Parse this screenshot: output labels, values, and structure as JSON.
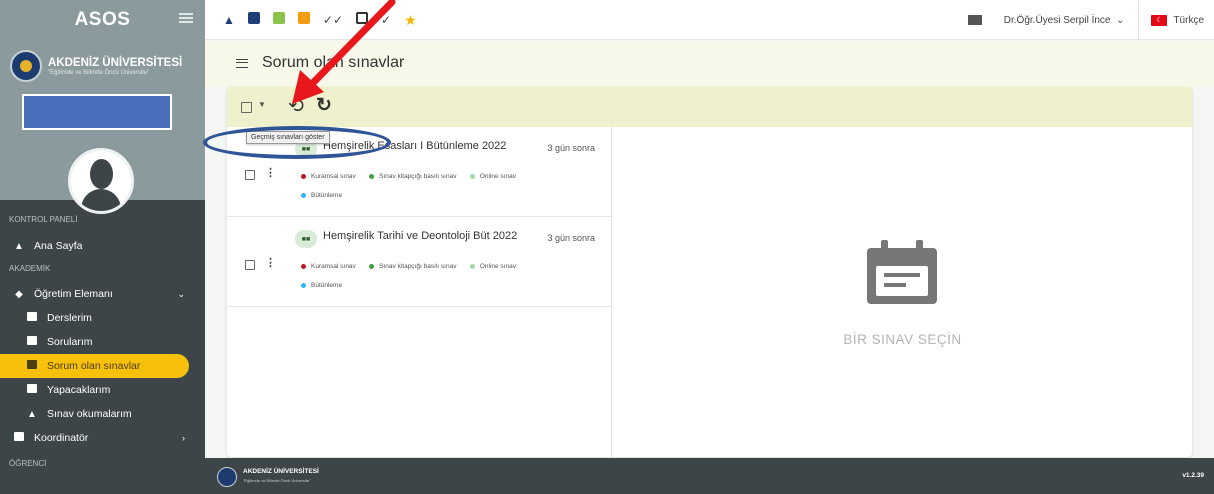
{
  "sidebar": {
    "brand": "ASOS",
    "university_name": "AKDENİZ ÜNİVERSİTESİ",
    "university_slogan": "\"Eğitimde ve Bilimde Öncü Üniversite\"",
    "sections": {
      "control_panel": "KONTROL PANELİ",
      "academic": "AKADEMİK",
      "student": "ÖĞRENCİ"
    },
    "items": {
      "home": "Ana Sayfa",
      "faculty": "Öğretim Elemanı",
      "courses": "Derslerim",
      "questions": "Sorularım",
      "my_exams": "Sorum olan sınavlar",
      "todo": "Yapacaklarım",
      "exam_readings": "Sınav okumalarım",
      "coordinator": "Koordinatör"
    }
  },
  "topbar": {
    "user_name": "Dr.Öğr.Üyesi Serpil İnce",
    "language": "Türkçe",
    "colors": {
      "accent_yellow": "#f7c00a",
      "sidebar_dark": "#3d4548"
    }
  },
  "page": {
    "title": "Sorum olan sınavlar"
  },
  "tooltip": {
    "text": "Geçmiş sınavları göster"
  },
  "exams": [
    {
      "title": "Hemşirelik Esasları I Bütünleme 2022",
      "when": "3 gün sonra",
      "tags": [
        "Kuramsal sınav",
        "Sınav kitapçığı basılı sınav",
        "Online sınav",
        "Bütünleme"
      ]
    },
    {
      "title": "Hemşirelik Tarihi ve Deontoloji Büt 2022",
      "when": "3 gün sonra",
      "tags": [
        "Kuramsal sınav",
        "Sınav kitapçığı basılı sınav",
        "Online sınav",
        "Bütünleme"
      ]
    }
  ],
  "detail": {
    "empty_text": "BİR SINAV SEÇİN"
  },
  "footer": {
    "university_name": "AKDENİZ ÜNİVERSİTESİ",
    "university_slogan": "\"Eğitimde ve Bilimde Öncü Üniversite\"",
    "version": "v1.2.39"
  }
}
